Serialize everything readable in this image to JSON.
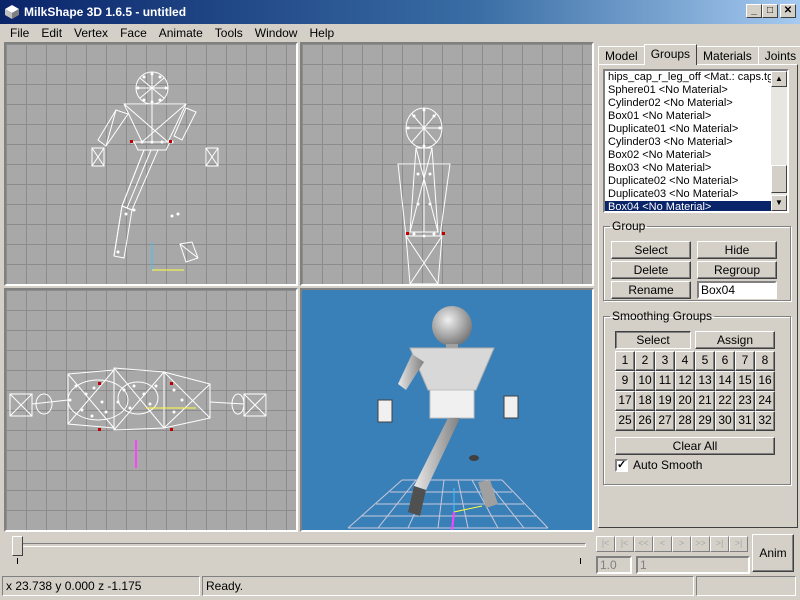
{
  "window": {
    "title": "MilkShape 3D 1.6.5 - untitled",
    "buttons": {
      "minimize": "_",
      "maximize": "□",
      "close": "✕"
    }
  },
  "menu": [
    "File",
    "Edit",
    "Vertex",
    "Face",
    "Animate",
    "Tools",
    "Window",
    "Help"
  ],
  "viewports": [
    {
      "name": "front",
      "style": "wireframe"
    },
    {
      "name": "side",
      "style": "wireframe"
    },
    {
      "name": "top",
      "style": "wireframe"
    },
    {
      "name": "3d",
      "style": "shaded"
    }
  ],
  "panel": {
    "tabs": [
      "Model",
      "Groups",
      "Materials",
      "Joints"
    ],
    "active_tab": "Groups",
    "groups_list": [
      "hips_cap_r_leg_off <Mat.: caps.tga",
      "Sphere01 <No Material>",
      "Cylinder02 <No Material>",
      "Box01 <No Material>",
      "Duplicate01 <No Material>",
      "Cylinder03 <No Material>",
      "Box02 <No Material>",
      "Box03 <No Material>",
      "Duplicate02 <No Material>",
      "Duplicate03 <No Material>",
      "Box04 <No Material>"
    ],
    "selected_index": 10,
    "group_box": {
      "legend": "Group",
      "select": "Select",
      "hide": "Hide",
      "delete": "Delete",
      "regroup": "Regroup",
      "rename": "Rename",
      "name_value": "Box04"
    },
    "smoothing": {
      "legend": "Smoothing Groups",
      "select": "Select",
      "assign": "Assign",
      "numbers": [
        "1",
        "2",
        "3",
        "4",
        "5",
        "6",
        "7",
        "8",
        "9",
        "10",
        "11",
        "12",
        "13",
        "14",
        "15",
        "16",
        "17",
        "18",
        "19",
        "20",
        "21",
        "22",
        "23",
        "24",
        "25",
        "26",
        "27",
        "28",
        "29",
        "30",
        "31",
        "32"
      ],
      "clear_all": "Clear All",
      "auto_smooth_label": "Auto Smooth",
      "auto_smooth_checked": true
    }
  },
  "animation": {
    "nav": [
      "|<",
      "|<",
      "<<",
      "<",
      ">",
      ">>",
      ">|",
      ">|"
    ],
    "frame_value": "1.0",
    "total_frames": "1",
    "anim_label": "Anim"
  },
  "status": {
    "coords": "x 23.738 y 0.000 z -1.175",
    "message": "Ready."
  },
  "colors": {
    "title_gradient_start": "#0a246a",
    "viewport_3d_bg": "#3a80b8",
    "selection": "#0a246a"
  }
}
